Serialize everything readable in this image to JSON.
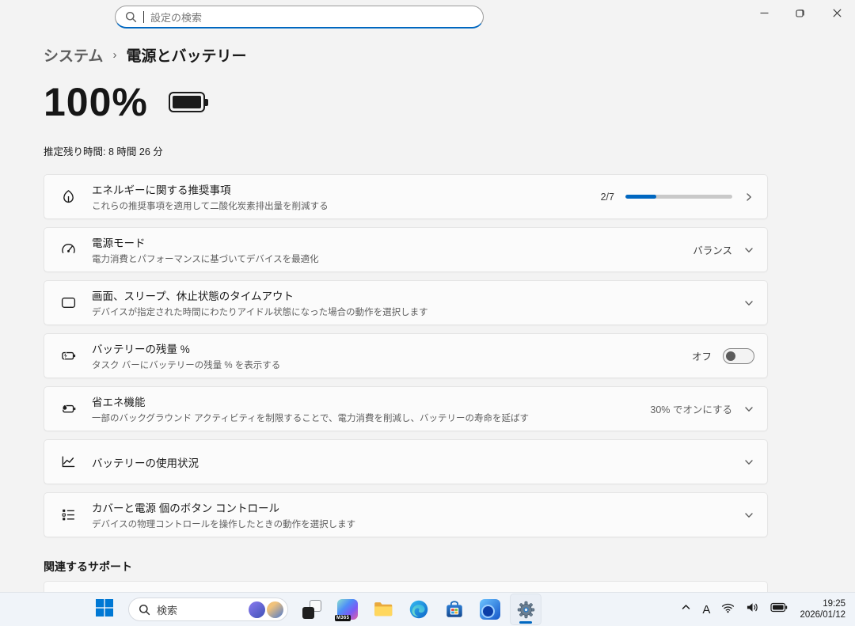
{
  "titlebar": {
    "search": {
      "placeholder": "設定の検索",
      "icon": "search-icon"
    },
    "controls": {
      "minimize": "minimize-icon",
      "restore": "restore-icon",
      "close": "close-icon"
    }
  },
  "breadcrumb": {
    "root": "システム",
    "separator": "›",
    "current": "電源とバッテリー"
  },
  "battery_status": {
    "percent": "100%",
    "icon": "battery-full-icon",
    "estimate_label": "推定残り時間:",
    "estimate_value": "8 時間 26 分"
  },
  "cards": [
    {
      "icon": "leaf-icon",
      "title": "エネルギーに関する推奨事項",
      "subtitle": "これらの推奨事項を適用して二酸化炭素排出量を削減する",
      "right": {
        "type": "progress",
        "label": "2/7",
        "percent": 28.6,
        "chevron": "chevron-right-icon"
      }
    },
    {
      "icon": "gauge-icon",
      "title": "電源モード",
      "subtitle": "電力消費とパフォーマンスに基づいてデバイスを最適化",
      "right": {
        "type": "dropdown",
        "label": "バランス",
        "chevron": "chevron-down-icon"
      }
    },
    {
      "icon": "display-sleep-icon",
      "title": "画面、スリープ、休止状態のタイムアウト",
      "subtitle": "デバイスが指定された時間にわたりアイドル状態になった場合の動作を選択します",
      "right": {
        "type": "expander",
        "chevron": "chevron-down-icon"
      }
    },
    {
      "icon": "battery-bolt-icon",
      "title": "バッテリーの残量 %",
      "subtitle": "タスク バーにバッテリーの残量 % を表示する",
      "right": {
        "type": "toggle",
        "label": "オフ",
        "state": "off"
      }
    },
    {
      "icon": "battery-leaf-icon",
      "title": "省エネ機能",
      "subtitle": "一部のバックグラウンド アクティビティを制限することで、電力消費を削減し、バッテリーの寿命を延ばす",
      "right": {
        "type": "dropdown",
        "label": "30% でオンにする",
        "chevron": "chevron-down-icon"
      }
    },
    {
      "icon": "line-chart-icon",
      "title": "バッテリーの使用状況",
      "subtitle": "",
      "right": {
        "type": "expander",
        "chevron": "chevron-down-icon"
      }
    },
    {
      "icon": "controls-list-icon",
      "title": "カバーと電源 個のボタン コントロール",
      "subtitle": "デバイスの物理コントロールを操作したときの動作を選択します",
      "right": {
        "type": "expander",
        "chevron": "chevron-down-icon"
      }
    }
  ],
  "related_support": {
    "heading": "関連するサポート"
  },
  "taskbar": {
    "start_icon": "windows-start-icon",
    "search_label": "検索",
    "apps": [
      "task-view",
      "copilot-m365",
      "file-explorer",
      "edge",
      "microsoft-store",
      "blue-app",
      "settings"
    ],
    "copilot_badge": "M365",
    "tray": {
      "hidden_icons": "chevron-up-icon",
      "ime": "A",
      "wifi": "wifi-icon",
      "volume": "volume-icon",
      "battery": "battery-tray-icon",
      "time": "19:25",
      "date": "2026/01/12"
    }
  },
  "colors": {
    "accent": "#0067c0",
    "page_bg": "#f3f3f3",
    "card_bg": "#fbfbfb",
    "taskbar_bg": "#f0f4f9"
  }
}
